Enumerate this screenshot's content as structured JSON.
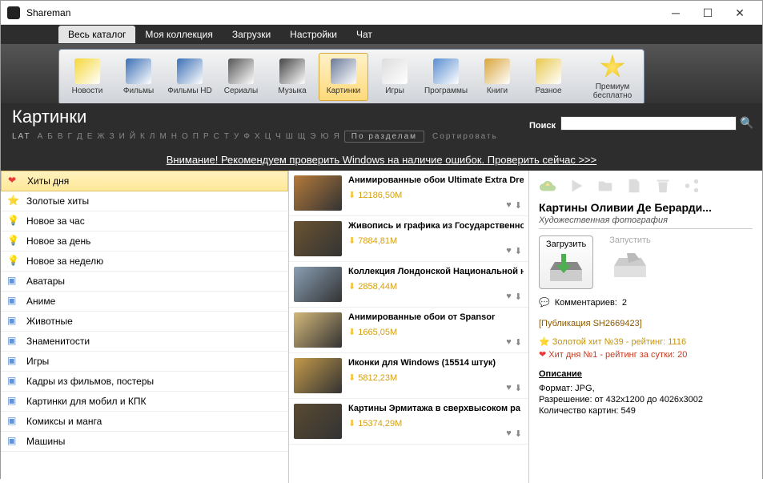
{
  "window": {
    "title": "Shareman"
  },
  "menu": [
    "Весь каталог",
    "Моя коллекция",
    "Загрузки",
    "Настройки",
    "Чат"
  ],
  "menu_active": 0,
  "toolbar": [
    {
      "name": "news",
      "label": "Новости",
      "color": "#f5d738"
    },
    {
      "name": "films",
      "label": "Фильмы",
      "color": "#3a6fb5"
    },
    {
      "name": "films-hd",
      "label": "Фильмы HD",
      "color": "#3a6fb5"
    },
    {
      "name": "series",
      "label": "Сериалы",
      "color": "#555"
    },
    {
      "name": "music",
      "label": "Музыка",
      "color": "#444"
    },
    {
      "name": "pictures",
      "label": "Картинки",
      "color": "#6a7a99",
      "active": true
    },
    {
      "name": "games",
      "label": "Игры",
      "color": "#ddd"
    },
    {
      "name": "programs",
      "label": "Программы",
      "color": "#5a8ed0"
    },
    {
      "name": "books",
      "label": "Книги",
      "color": "#d9a53a"
    },
    {
      "name": "misc",
      "label": "Разное",
      "color": "#e8c84c"
    }
  ],
  "premium": {
    "label": "Премиум\nбесплатно"
  },
  "section": {
    "title": "Картинки"
  },
  "search": {
    "label": "Поиск"
  },
  "alpha": {
    "lat": "LAT",
    "letters": [
      "А",
      "Б",
      "В",
      "Г",
      "Д",
      "Е",
      "Ж",
      "З",
      "И",
      "Й",
      "К",
      "Л",
      "М",
      "Н",
      "О",
      "П",
      "Р",
      "С",
      "Т",
      "У",
      "Ф",
      "Х",
      "Ц",
      "Ч",
      "Ш",
      "Щ",
      "Э",
      "Ю",
      "Я"
    ],
    "by_sections": "По разделам",
    "sort": "Сортировать"
  },
  "warning": "Внимание! Рекомендуем проверить Windows на наличие ошибок. Проверить сейчас >>>",
  "sidebar": [
    {
      "icon": "heart",
      "label": "Хиты дня",
      "active": true
    },
    {
      "icon": "star",
      "label": "Золотые хиты"
    },
    {
      "icon": "bulb",
      "label": "Новое за час"
    },
    {
      "icon": "bulb",
      "label": "Новое за день"
    },
    {
      "icon": "bulb",
      "label": "Новое за неделю"
    },
    {
      "icon": "folder",
      "label": "Аватары"
    },
    {
      "icon": "folder",
      "label": "Аниме"
    },
    {
      "icon": "folder",
      "label": "Животные"
    },
    {
      "icon": "folder",
      "label": "Знаменитости"
    },
    {
      "icon": "folder",
      "label": "Игры"
    },
    {
      "icon": "folder",
      "label": "Кадры из фильмов, постеры"
    },
    {
      "icon": "folder",
      "label": "Картинки для мобил и КПК"
    },
    {
      "icon": "folder",
      "label": "Комиксы и манга"
    },
    {
      "icon": "folder",
      "label": "Машины"
    }
  ],
  "list": [
    {
      "title": "Анимированные обои Ultimate Extra Dre",
      "size": "12186,50M",
      "thumb": "#b57a3a"
    },
    {
      "title": "Живопись и графика из Государственно",
      "size": "7884,81M",
      "thumb": "#6b5432"
    },
    {
      "title": "Коллекция Лондонской Национальной н",
      "size": "2858,44M",
      "thumb": "#8a9fb5"
    },
    {
      "title": "Анимированные обои от Spansor",
      "size": "1665,05M",
      "thumb": "#d4b87a"
    },
    {
      "title": "Иконки для Windows  (15514 штук)",
      "size": "5812,23M",
      "thumb": "#c49a4a"
    },
    {
      "title": "Картины Эрмитажа в сверхвысоком ра",
      "size": "15374,29M",
      "thumb": "#5a4a32"
    }
  ],
  "detail": {
    "title": "Картины Оливии Де Берарди...",
    "subtitle": "Художественная фотография",
    "download": "Загрузить",
    "launch": "Запустить",
    "comments_label": "Комментариев:",
    "comments_count": "2",
    "pub_id": "[Публикация SH2669423]",
    "gold_hit": "Золотой хит №39 - рейтинг: 1116",
    "day_hit": "Хит дня №1 - рейтинг за сутки: 20",
    "desc_head": "Описание",
    "format": "Формат: JPG,",
    "resolution": "Разрешение: от 432х1200 до 4026х3002",
    "count": "Количество картин: 549"
  }
}
